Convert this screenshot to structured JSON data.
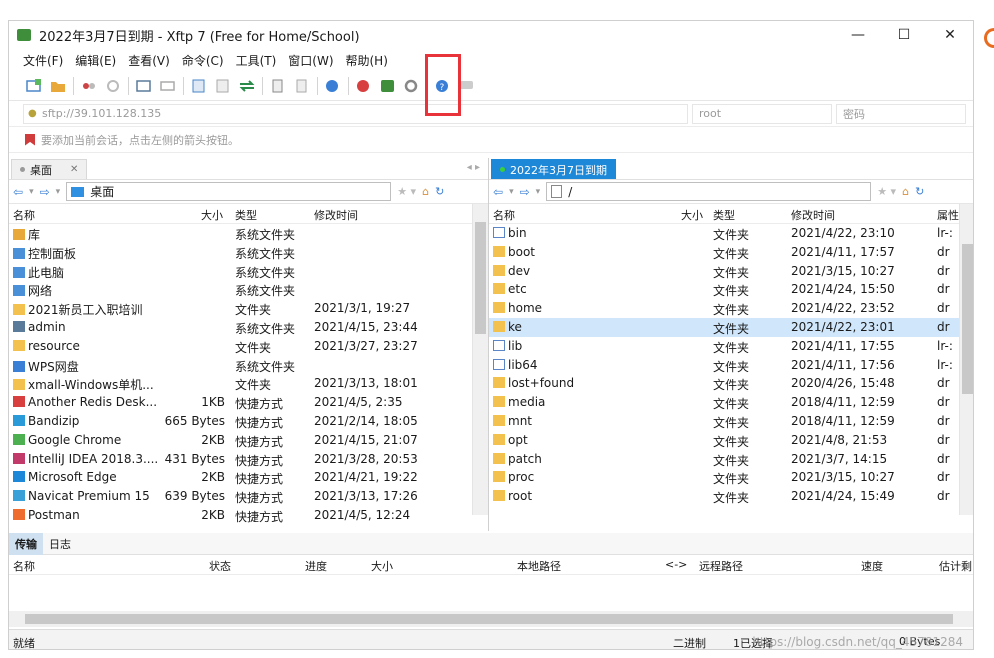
{
  "window": {
    "title": "2022年3月7日到期 - Xftp 7 (Free for Home/School)",
    "minimize": "—",
    "maximize": "☐",
    "close": "✕"
  },
  "menu": [
    "文件(F)",
    "编辑(E)",
    "查看(V)",
    "命令(C)",
    "工具(T)",
    "窗口(W)",
    "帮助(H)"
  ],
  "address": {
    "host_placeholder": "sftp://39.101.128.135",
    "user_placeholder": "root",
    "password_placeholder": "密码"
  },
  "hint": "要添加当前会话，点击左侧的箭头按钮。",
  "left_pane": {
    "tab_label": "桌面",
    "path": "桌面",
    "columns": [
      "名称",
      "大小",
      "类型",
      "修改时间"
    ],
    "rows": [
      {
        "name": "库",
        "size": "",
        "type": "系统文件夹",
        "modified": "",
        "icon": "library-icon"
      },
      {
        "name": "控制面板",
        "size": "",
        "type": "系统文件夹",
        "modified": "",
        "icon": "control-panel-icon"
      },
      {
        "name": "此电脑",
        "size": "",
        "type": "系统文件夹",
        "modified": "",
        "icon": "computer-icon"
      },
      {
        "name": "网络",
        "size": "",
        "type": "系统文件夹",
        "modified": "",
        "icon": "network-icon"
      },
      {
        "name": "2021新员工入职培训",
        "size": "",
        "type": "文件夹",
        "modified": "2021/3/1, 19:27",
        "icon": "folder-icon"
      },
      {
        "name": "admin",
        "size": "",
        "type": "系统文件夹",
        "modified": "2021/4/15, 23:44",
        "icon": "user-icon"
      },
      {
        "name": "resource",
        "size": "",
        "type": "文件夹",
        "modified": "2021/3/27, 23:27",
        "icon": "folder-icon"
      },
      {
        "name": "WPS网盘",
        "size": "",
        "type": "系统文件夹",
        "modified": "",
        "icon": "cloud-icon"
      },
      {
        "name": "xmall-Windows单机...",
        "size": "",
        "type": "文件夹",
        "modified": "2021/3/13, 18:01",
        "icon": "folder-icon"
      },
      {
        "name": "Another Redis Desk...",
        "size": "1KB",
        "type": "快捷方式",
        "modified": "2021/4/5, 2:35",
        "icon": "redis-icon"
      },
      {
        "name": "Bandizip",
        "size": "665 Bytes",
        "type": "快捷方式",
        "modified": "2021/2/14, 18:05",
        "icon": "bandizip-icon"
      },
      {
        "name": "Google Chrome",
        "size": "2KB",
        "type": "快捷方式",
        "modified": "2021/4/15, 21:07",
        "icon": "chrome-icon"
      },
      {
        "name": "IntelliJ IDEA 2018.3....",
        "size": "431 Bytes",
        "type": "快捷方式",
        "modified": "2021/3/28, 20:53",
        "icon": "intellij-icon"
      },
      {
        "name": "Microsoft Edge",
        "size": "2KB",
        "type": "快捷方式",
        "modified": "2021/4/21, 19:22",
        "icon": "edge-icon"
      },
      {
        "name": "Navicat Premium 15",
        "size": "639 Bytes",
        "type": "快捷方式",
        "modified": "2021/3/13, 17:26",
        "icon": "navicat-icon"
      },
      {
        "name": "Postman",
        "size": "2KB",
        "type": "快捷方式",
        "modified": "2021/4/5, 12:24",
        "icon": "postman-icon"
      }
    ]
  },
  "right_pane": {
    "tab_label": "2022年3月7日到期",
    "path": "/",
    "columns": [
      "名称",
      "大小",
      "类型",
      "修改时间",
      "属性"
    ],
    "rows": [
      {
        "name": "bin",
        "type": "文件夹",
        "modified": "2021/4/22, 23:10",
        "attr": "lr-:",
        "icon": "link-icon"
      },
      {
        "name": "boot",
        "type": "文件夹",
        "modified": "2021/4/11, 17:57",
        "attr": "dr",
        "icon": "folder-icon"
      },
      {
        "name": "dev",
        "type": "文件夹",
        "modified": "2021/3/15, 10:27",
        "attr": "dr",
        "icon": "folder-icon"
      },
      {
        "name": "etc",
        "type": "文件夹",
        "modified": "2021/4/24, 15:50",
        "attr": "dr",
        "icon": "folder-icon"
      },
      {
        "name": "home",
        "type": "文件夹",
        "modified": "2021/4/22, 23:52",
        "attr": "dr",
        "icon": "folder-icon"
      },
      {
        "name": "ke",
        "type": "文件夹",
        "modified": "2021/4/22, 23:01",
        "attr": "dr",
        "icon": "folder-icon",
        "selected": true
      },
      {
        "name": "lib",
        "type": "文件夹",
        "modified": "2021/4/11, 17:55",
        "attr": "lr-:",
        "icon": "link-icon"
      },
      {
        "name": "lib64",
        "type": "文件夹",
        "modified": "2021/4/11, 17:56",
        "attr": "lr-:",
        "icon": "link-icon"
      },
      {
        "name": "lost+found",
        "type": "文件夹",
        "modified": "2020/4/26, 15:48",
        "attr": "dr",
        "icon": "folder-icon"
      },
      {
        "name": "media",
        "type": "文件夹",
        "modified": "2018/4/11, 12:59",
        "attr": "dr",
        "icon": "folder-icon"
      },
      {
        "name": "mnt",
        "type": "文件夹",
        "modified": "2018/4/11, 12:59",
        "attr": "dr",
        "icon": "folder-icon"
      },
      {
        "name": "opt",
        "type": "文件夹",
        "modified": "2021/4/8, 21:53",
        "attr": "dr",
        "icon": "folder-icon"
      },
      {
        "name": "patch",
        "type": "文件夹",
        "modified": "2021/3/7, 14:15",
        "attr": "dr",
        "icon": "folder-icon"
      },
      {
        "name": "proc",
        "type": "文件夹",
        "modified": "2021/3/15, 10:27",
        "attr": "dr",
        "icon": "folder-icon"
      },
      {
        "name": "root",
        "type": "文件夹",
        "modified": "2021/4/24, 15:49",
        "attr": "dr",
        "icon": "folder-icon"
      }
    ]
  },
  "lower": {
    "tabs": [
      "传输",
      "日志"
    ],
    "columns": [
      "名称",
      "状态",
      "进度",
      "大小",
      "本地路径",
      "<->",
      "远程路径",
      "速度",
      "估计剩"
    ]
  },
  "status": {
    "left": "就绪",
    "mode": "二进制",
    "selected": "1已选择",
    "size": "0 Bytes"
  },
  "watermark": "https://blog.csdn.net/qq_45781284"
}
